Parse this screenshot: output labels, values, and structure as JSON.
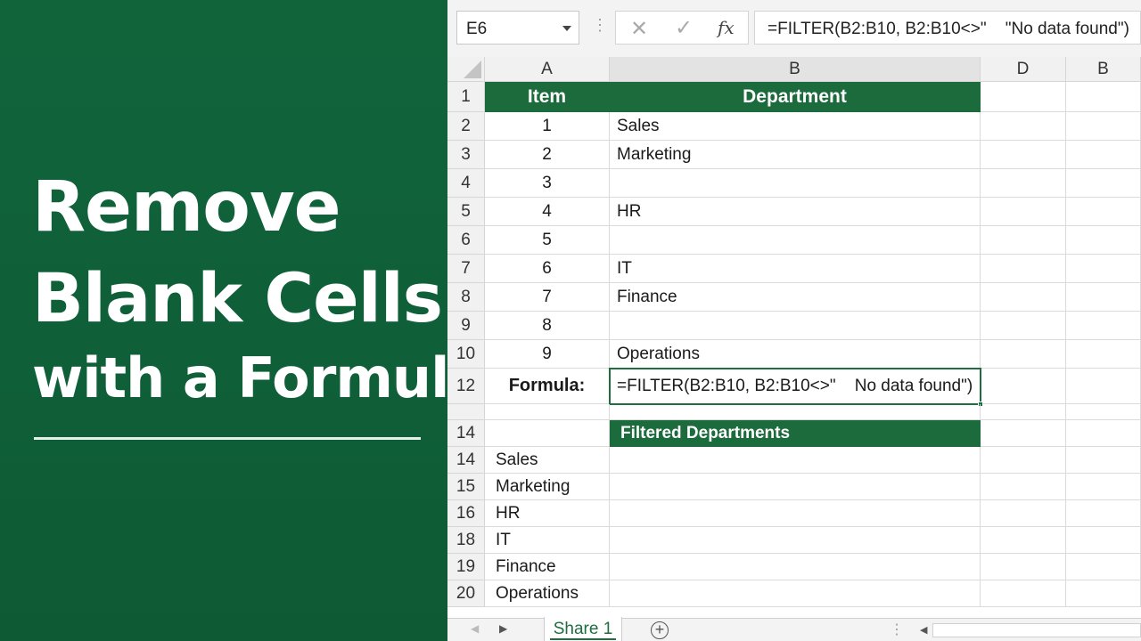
{
  "title": {
    "line1": "Remove",
    "line2": "Blank Cells",
    "line3": "with a Formula"
  },
  "formula_bar": {
    "name_box": "E6",
    "dots": "⋮",
    "cancel_glyph": "✕",
    "enter_glyph": "✓",
    "fx_glyph": "fx",
    "formula": "=FILTER(B2:B10, B2:B10<>\"    \"No data found\")"
  },
  "columns": [
    "A",
    "B",
    "D",
    "B"
  ],
  "rows": [
    {
      "num": "1",
      "a": "Item",
      "b": "Department",
      "type": "header"
    },
    {
      "num": "2",
      "a": "1",
      "b": "Sales"
    },
    {
      "num": "3",
      "a": "2",
      "b": "Marketing"
    },
    {
      "num": "4",
      "a": "3",
      "b": ""
    },
    {
      "num": "5",
      "a": "4",
      "b": "HR"
    },
    {
      "num": "6",
      "a": "5",
      "b": ""
    },
    {
      "num": "7",
      "a": "6",
      "b": "IT"
    },
    {
      "num": "8",
      "a": "7",
      "b": "Finance"
    },
    {
      "num": "9",
      "a": "8",
      "b": ""
    },
    {
      "num": "10",
      "a": "9",
      "b": "Operations"
    },
    {
      "num": "12",
      "a": "Formula:",
      "b": "=FILTER(B2:B10, B2:B10<>\"    No data found\")",
      "type": "formula"
    },
    {
      "num": "",
      "a": "",
      "b": "",
      "type": "spacer"
    },
    {
      "num": "14",
      "a": "",
      "b": "Filtered Departments",
      "type": "subheader"
    },
    {
      "num": "14",
      "a": "Sales",
      "b": "",
      "type": "result"
    },
    {
      "num": "15",
      "a": "Marketing",
      "b": "",
      "type": "result"
    },
    {
      "num": "16",
      "a": "HR",
      "b": "",
      "type": "result"
    },
    {
      "num": "18",
      "a": "IT",
      "b": "",
      "type": "result"
    },
    {
      "num": "19",
      "a": "Finance",
      "b": "",
      "type": "result"
    },
    {
      "num": "20",
      "a": "Operations",
      "b": "",
      "type": "result"
    }
  ],
  "tabs": {
    "sheet_name": "Share 1",
    "add_glyph": "+",
    "prev_glyph": "◀",
    "next_glyph": "▶",
    "dots": "⋮"
  },
  "colors": {
    "brand_green": "#1c6b3d",
    "panel_green": "#0f6039"
  }
}
